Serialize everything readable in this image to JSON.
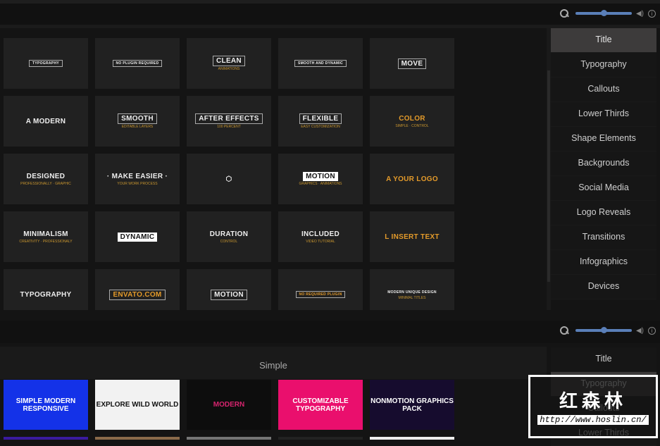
{
  "toolbar": {
    "zoom_level": 0.5,
    "icons": [
      "search-icon",
      "volume-icon",
      "info-icon"
    ],
    "info_glyph": "i",
    "volume_glyph": "◀)"
  },
  "categories": [
    "Title",
    "Typography",
    "Callouts",
    "Lower Thirds",
    "Shape Elements",
    "Backgrounds",
    "Social Media",
    "Logo Reveals",
    "Transitions",
    "Infographics",
    "Devices"
  ],
  "selected_category_top": "Title",
  "selected_category_bottom": "Typography",
  "grid_thumbnails": [
    {
      "t1": "TYPOGRAPHY",
      "t2": "",
      "style": "boxed small"
    },
    {
      "t1": "NO PLUGIN REQUIRED",
      "t2": "",
      "style": "boxed small"
    },
    {
      "t1": "CLEAN",
      "t2": "ANIMATIONS",
      "style": "boxed"
    },
    {
      "t1": "SMOOTH AND DYNAMIC",
      "t2": "",
      "style": "boxed small"
    },
    {
      "t1": "MOVE",
      "t2": "",
      "style": "boxed"
    },
    {
      "t1": "A  MODERN",
      "t2": "",
      "style": ""
    },
    {
      "t1": "SMOOTH",
      "t2": "EDITABLE LAYERS",
      "style": "boxed"
    },
    {
      "t1": "AFTER EFFECTS",
      "t2": "100 PERCENT",
      "style": "boxed"
    },
    {
      "t1": "FLEXIBLE",
      "t2": "EASY CUSTOMIZATION",
      "style": "boxed"
    },
    {
      "t1": "COLOR",
      "t2": "SIMPLE · CONTROL",
      "style": "gold"
    },
    {
      "t1": "DESIGNED",
      "t2": "PROFESSIONALLY · GRAPHIC",
      "style": ""
    },
    {
      "t1": "· MAKE EASIER ·",
      "t2": "YOUR WORK PROCESS",
      "style": ""
    },
    {
      "t1": "⬡",
      "t2": "",
      "style": ""
    },
    {
      "t1": "MOTION",
      "t2": "GRAPHICS · ANIMATIONS",
      "style": "white"
    },
    {
      "t1": "A  YOUR LOGO",
      "t2": "",
      "style": "gold"
    },
    {
      "t1": "MINIMALISM",
      "t2": "CREATIVITY · PROFESSIONALY",
      "style": ""
    },
    {
      "t1": "DYNAMIC",
      "t2": "",
      "style": "white"
    },
    {
      "t1": "DURATION",
      "t2": "CONTROL",
      "style": ""
    },
    {
      "t1": "INCLUDED",
      "t2": "VIDEO TUTORIAL",
      "style": ""
    },
    {
      "t1": "L  INSERT TEXT",
      "t2": "",
      "style": "gold"
    },
    {
      "t1": "TYPOGRAPHY",
      "t2": "",
      "style": ""
    },
    {
      "t1": "ENVATO.COM",
      "t2": "",
      "style": "gold boxed"
    },
    {
      "t1": "MOTION",
      "t2": "",
      "style": "boxed"
    },
    {
      "t1": "NO REQUIRED PLUGIN",
      "t2": "",
      "style": "gold boxed small"
    },
    {
      "t1": "MODERN UNIQUE DESIGN",
      "t2": "MINIMAL TITLES",
      "style": "small"
    }
  ],
  "section_title": "Simple",
  "simple_thumbnails": [
    {
      "text": "SIMPLE MODERN RESPONSIVE",
      "bg": "#1432e8",
      "fg": "#ffffff"
    },
    {
      "text": "EXPLORE WILD WORLD",
      "bg": "#f2f2f2",
      "fg": "#111111"
    },
    {
      "text": "MODERN",
      "bg": "#0d0d0d",
      "fg": "#d6246e"
    },
    {
      "text": "CUSTOMIZABLE TYPOGRAPHY",
      "bg": "#ea0f6d",
      "fg": "#ffffff"
    },
    {
      "text": "NONMOTION GRAPHICS PACK",
      "bg": "#160c2e",
      "fg": "#ffffff"
    }
  ],
  "watermark": {
    "chinese": "红森林",
    "url": "http://www.hoslin.cn/"
  },
  "colors": {
    "accent": "#5a7fb8",
    "gold": "#e39a2a",
    "selected": "#3d3b3b"
  }
}
